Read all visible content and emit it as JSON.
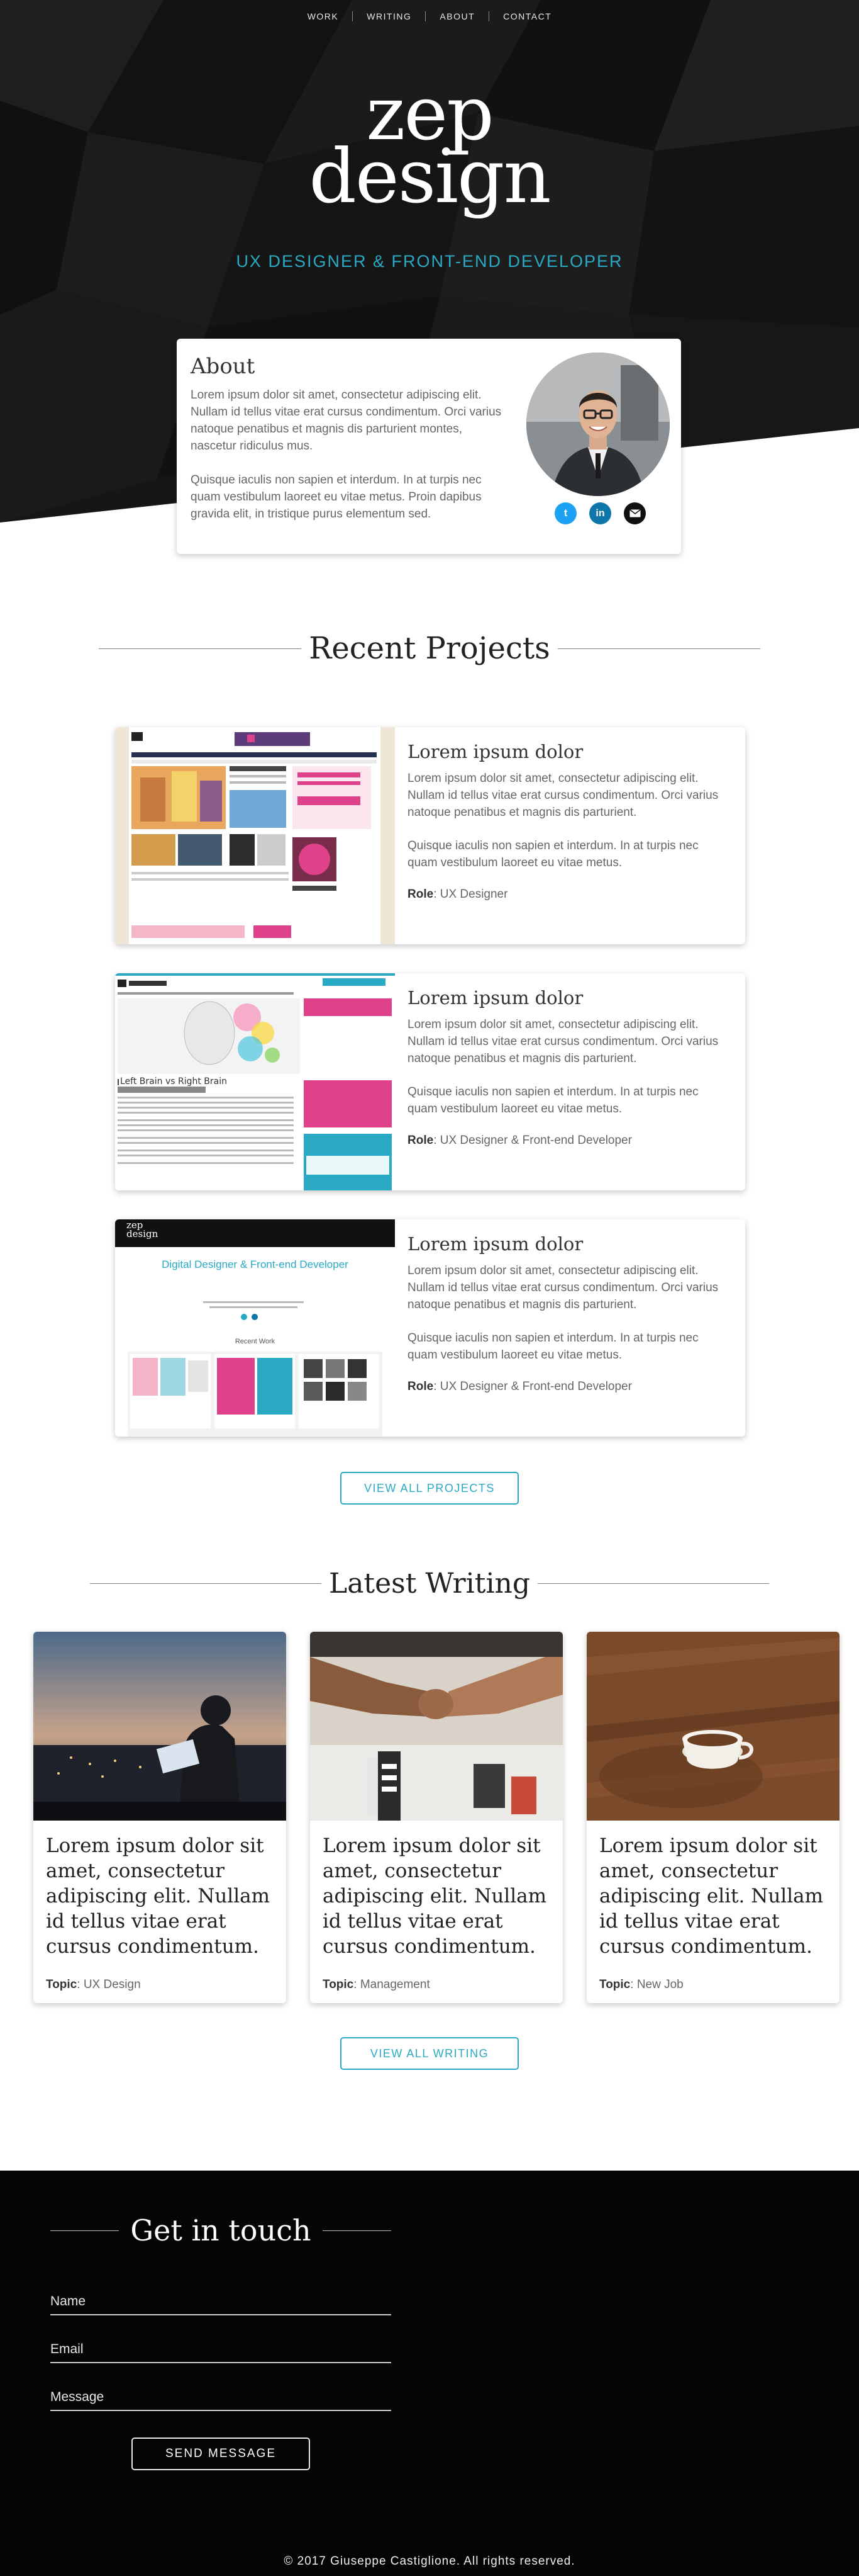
{
  "nav": {
    "items": [
      "WORK",
      "WRITING",
      "ABOUT",
      "CONTACT"
    ]
  },
  "hero": {
    "logo_line1": "zep",
    "logo_line2": "design",
    "tagline": "UX DESIGNER & FRONT-END DEVELOPER"
  },
  "about": {
    "title": "About",
    "p1": "Lorem ipsum dolor sit amet, consectetur adipiscing elit. Nullam id tellus vitae erat cursus condimentum. Orci varius natoque penatibus et magnis dis parturient montes, nascetur ridiculus mus.",
    "p2": "Quisque iaculis non sapien et interdum. In at turpis nec quam vestibulum laoreet eu vitae metus. Proin dapibus gravida elit, in tristique purus elementum sed.",
    "socials": [
      {
        "icon": "twitter-icon",
        "color": "#1da1f2"
      },
      {
        "icon": "linkedin-icon",
        "color": "#0e76a8"
      },
      {
        "icon": "email-icon",
        "color": "#111111"
      }
    ]
  },
  "projects": {
    "title": "Recent Projects",
    "items": [
      {
        "title": "Lorem ipsum dolor",
        "p1": "Lorem ipsum dolor sit amet, consectetur adipiscing elit. Nullam id tellus vitae erat cursus condimentum. Orci varius natoque penatibus et magnis dis parturient.",
        "p2": "Quisque iaculis non sapien et interdum. In at turpis nec quam vestibulum laoreet eu vitae metus.",
        "role_label": "Role",
        "role": ": UX Designer",
        "thumb": {
          "brand": "Grapevine",
          "badge": "HR"
        }
      },
      {
        "title": "Lorem ipsum dolor",
        "p1": "Lorem ipsum dolor sit amet, consectetur adipiscing elit. Nullam id tellus vitae erat cursus condimentum. Orci varius natoque penatibus et magnis dis parturient.",
        "p2": "Quisque iaculis non sapien et interdum. In at turpis nec quam vestibulum laoreet eu vitae metus.",
        "role_label": "Role",
        "role": ": UX Designer & Front-end Developer",
        "thumb": {
          "brand": "Grapevine",
          "badge": "HR",
          "heading": "Left Brain vs Right Brain"
        }
      },
      {
        "title": "Lorem ipsum dolor",
        "p1": "Lorem ipsum dolor sit amet, consectetur adipiscing elit. Nullam id tellus vitae erat cursus condimentum. Orci varius natoque penatibus et magnis dis parturient.",
        "p2": "Quisque iaculis non sapien et interdum. In at turpis nec quam vestibulum laoreet eu vitae metus.",
        "role_label": "Role",
        "role": ": UX Designer & Front-end Developer",
        "thumb": {
          "logo1": "zep",
          "logo2": "design",
          "heading": "Digital Designer & Front-end Developer",
          "sub": "Recent Work"
        }
      }
    ],
    "button": "VIEW ALL PROJECTS"
  },
  "writing": {
    "title": "Latest Writing",
    "posts": [
      {
        "title": "Lorem ipsum dolor sit amet, consectetur adipiscing elit. Nullam id tellus vitae erat cursus condimentum.",
        "topic_label": "Topic",
        "topic": ": UX Design"
      },
      {
        "title": "Lorem ipsum dolor sit amet, consectetur adipiscing elit. Nullam id tellus vitae erat cursus condimentum.",
        "topic_label": "Topic",
        "topic": ": Management"
      },
      {
        "title": "Lorem ipsum dolor sit amet, consectetur adipiscing elit. Nullam id tellus vitae erat cursus condimentum.",
        "topic_label": "Topic",
        "topic": ": New Job"
      }
    ],
    "button": "VIEW ALL WRITING"
  },
  "contact": {
    "title": "Get in touch",
    "fields": [
      "Name",
      "Email",
      "Message"
    ],
    "button": "SEND MESSAGE"
  },
  "footer": {
    "copyright": "© 2017 Giuseppe Castiglione. All rights reserved."
  },
  "colors": {
    "accent": "#2aa9c4",
    "dark": "#141414",
    "footer": "#050505"
  }
}
